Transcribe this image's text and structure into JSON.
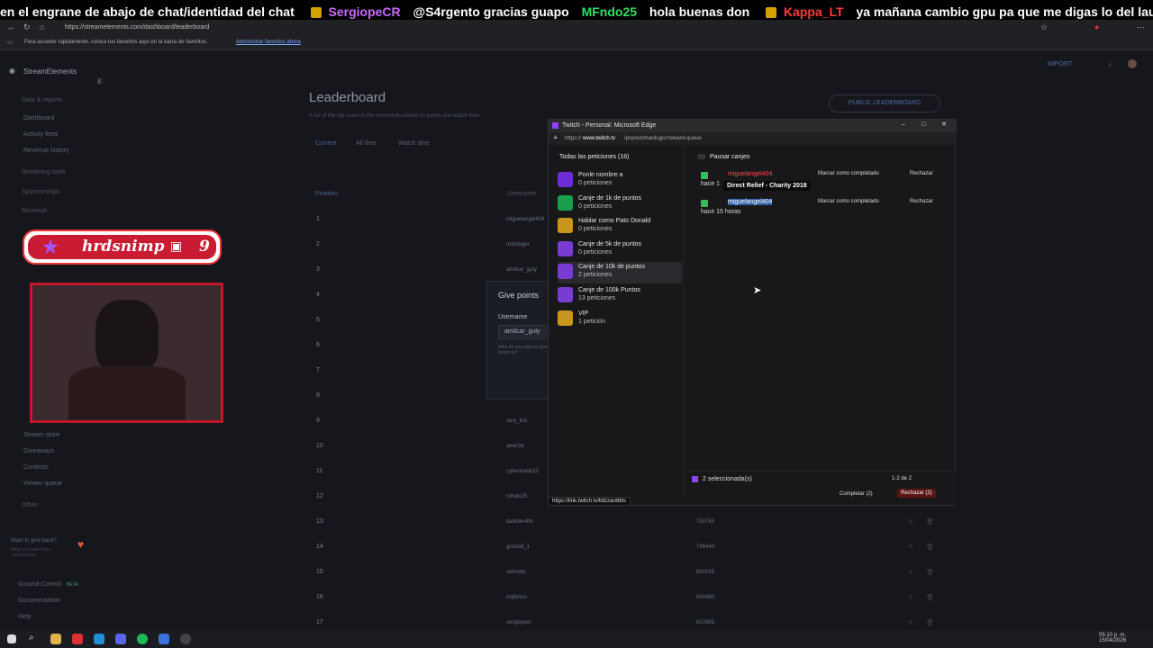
{
  "ticker": {
    "m1": "en el engrane de abajo de chat/identidad del chat",
    "m2_user": "SergiopeCR",
    "m2_text": "@S4rgento gracias guapo",
    "m3_user": "MFndo25",
    "m3_text": "hola buenas don",
    "m4_user": "Kappa_LT",
    "m4_text": "ya mañana cambio gpu pa que me digas lo del launcher"
  },
  "browser": {
    "url": "https://streamelements.com/dashboard/leaderboard",
    "bookmarks_hint": "Para acceder rápidamente, coloca tus favoritos aquí en la barra de favoritos.",
    "bookmarks_link": "Administrar favoritos ahora"
  },
  "sidebar": {
    "brand": "StreamElements",
    "section_data": "Data & reports",
    "items": [
      "Dashboard",
      "Activity feed",
      "Revenue history"
    ],
    "section_tools": "Streaming tools",
    "sponsorships": "Sponsorships",
    "revenue": "Revenue",
    "lower_items": [
      "Stream store",
      "Giveaways",
      "Contests",
      "Viewer queue"
    ],
    "other": "Other",
    "give_back": "Want to give back?",
    "give_back_sub": "Help us power more communities",
    "ground_control": "Ground Control",
    "beta": "BETA",
    "documentation": "Documentation",
    "help": "Help"
  },
  "main": {
    "title": "Leaderboard",
    "desc": "A list of the top users in the community based on points and watch time.",
    "public_btn": "PUBLIC LEADERBOARD",
    "import": "IMPORT",
    "tabs": [
      "Current",
      "All time",
      "Watch time"
    ],
    "col_position": "Position",
    "col_username": "Username",
    "rows": [
      {
        "n": "1",
        "u": "miguelangel404",
        "p": ""
      },
      {
        "n": "2",
        "u": "marduger",
        "p": ""
      },
      {
        "n": "3",
        "u": "amilcar_guty",
        "p": ""
      },
      {
        "n": "4",
        "u": "",
        "p": ""
      },
      {
        "n": "5",
        "u": "",
        "p": ""
      },
      {
        "n": "6",
        "u": "",
        "p": ""
      },
      {
        "n": "7",
        "u": "",
        "p": ""
      },
      {
        "n": "8",
        "u": "",
        "p": ""
      },
      {
        "n": "9",
        "u": "sery_bot",
        "p": ""
      },
      {
        "n": "10",
        "u": "awer3d",
        "p": ""
      },
      {
        "n": "11",
        "u": "cybermask23",
        "p": ""
      },
      {
        "n": "12",
        "u": "mfndo25",
        "p": ""
      },
      {
        "n": "13",
        "u": "darkdev4th",
        "p": "750769"
      },
      {
        "n": "14",
        "u": "gonzalt_1",
        "p": "746440"
      },
      {
        "n": "15",
        "u": "solmatic",
        "p": "691545"
      },
      {
        "n": "16",
        "u": "irdjferico",
        "p": "654480"
      },
      {
        "n": "17",
        "u": "sergiopecr",
        "p": "637855"
      }
    ]
  },
  "give_points": {
    "title": "Give points",
    "username_label": "Username",
    "username_value": "amilcar_guty",
    "hint": "Who do you want to give points to?"
  },
  "overlay": {
    "badge": "hrdsnimp",
    "badge_count": "9"
  },
  "popup": {
    "title": "Twitch - Personal: Microsoft Edge",
    "url_prefix": "https://",
    "url_host": "www.twitch.tv",
    "url_path": "/popout/mardugcr/reward-queue",
    "all_requests": "Todas las peticiones (16)",
    "pause": "Pausar canjes",
    "rewards": [
      {
        "name": "Ponle nombre a",
        "count": "0 peticiones",
        "color": "#6c2cd6"
      },
      {
        "name": "Canje de 1k de puntos",
        "count": "0 peticiones",
        "color": "#1b9e4b"
      },
      {
        "name": "Hablar como Pato Donald",
        "count": "0 peticiones",
        "color": "#c9951d"
      },
      {
        "name": "Canje de 5k de puntos",
        "count": "0 peticiones",
        "color": "#7a3bd0"
      },
      {
        "name": "Canje de 10k de puntos",
        "count": "2 peticiones",
        "color": "#7a3bd0"
      },
      {
        "name": "Canje de 100k Puntos",
        "count": "13 peticiones",
        "color": "#7a3bd0"
      },
      {
        "name": "VIP",
        "count": "1 petición",
        "color": "#c9951d"
      }
    ],
    "requests": [
      {
        "user": "miguelangel404",
        "time": "hace 1"
      },
      {
        "user": "miguelangel404",
        "time": "hace 15 horas"
      }
    ],
    "tooltip": "Direct Relief - Charity 2018",
    "mark_done": "Marcar como completado",
    "reject": "Rechazar",
    "selected": "2 seleccionada(s)",
    "range": "1-2 de 2",
    "complete_btn": "Completar (2)",
    "reject_btn": "Rechazar (2)",
    "status_url": "https://link.twitch.tv/blizzardbits"
  },
  "taskbar": {
    "time": "05:10 p. m.",
    "date": "15/04/2026"
  }
}
